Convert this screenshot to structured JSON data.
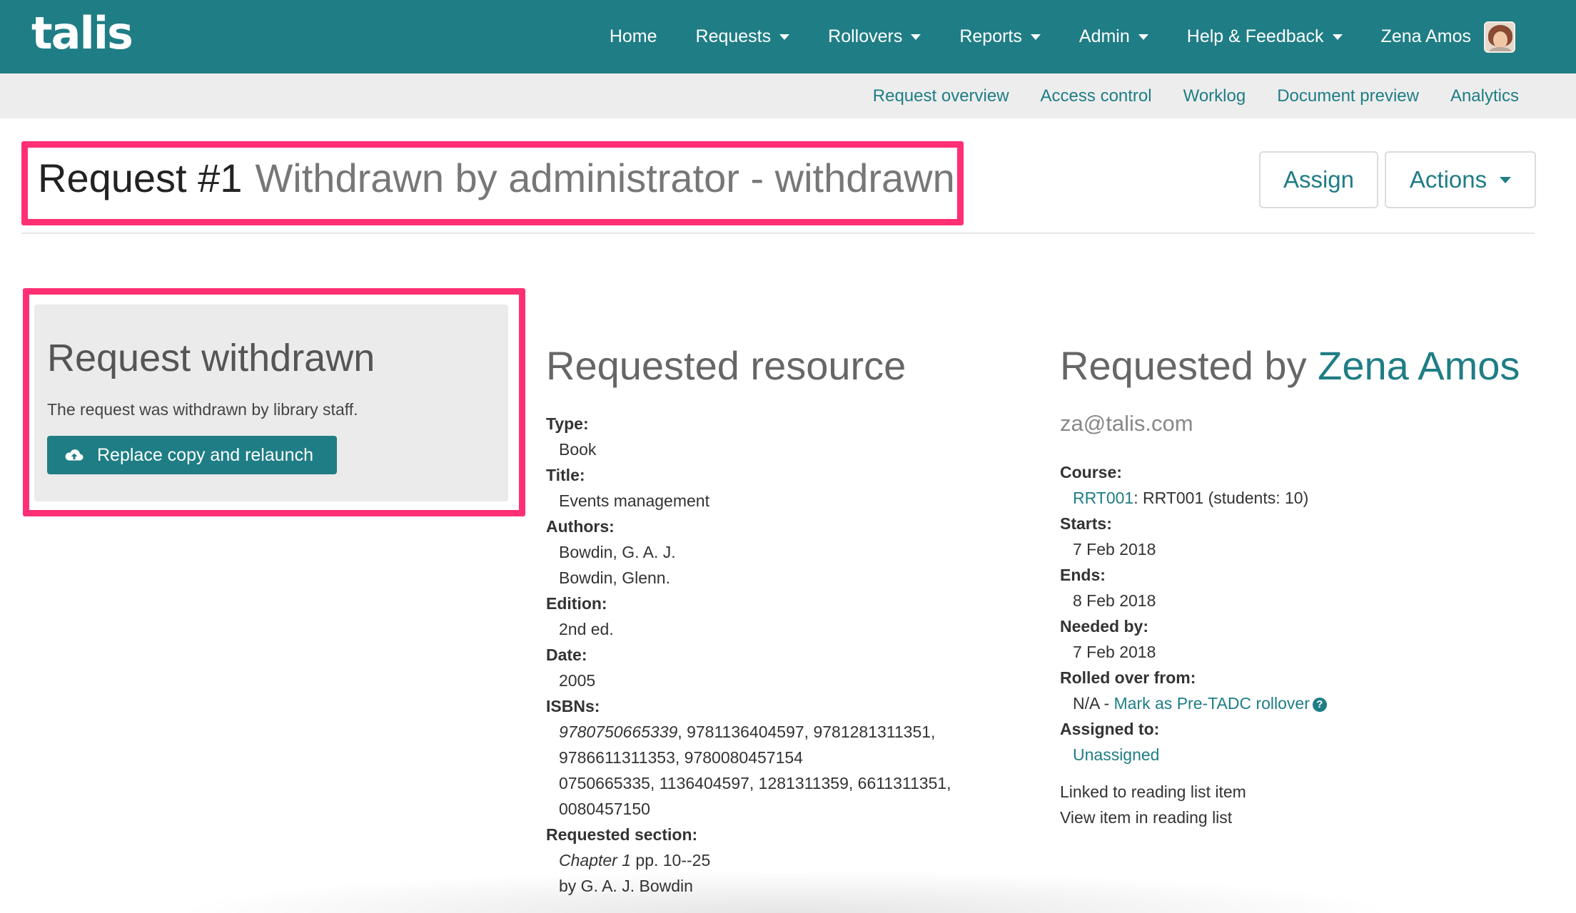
{
  "nav": {
    "logo": "talis",
    "items": [
      {
        "label": "Home",
        "dropdown": false
      },
      {
        "label": "Requests",
        "dropdown": true
      },
      {
        "label": "Rollovers",
        "dropdown": true
      },
      {
        "label": "Reports",
        "dropdown": true
      },
      {
        "label": "Admin",
        "dropdown": true
      },
      {
        "label": "Help & Feedback",
        "dropdown": true
      }
    ],
    "user_name": "Zena Amos",
    "bg_color": "#1f7d85"
  },
  "subnav": {
    "items": [
      "Request overview",
      "Access control",
      "Worklog",
      "Document preview",
      "Analytics"
    ]
  },
  "header": {
    "request": "Request #1",
    "status": "Withdrawn by administrator - withdrawn",
    "assign_label": "Assign",
    "actions_label": "Actions"
  },
  "withdrawn_panel": {
    "title": "Request withdrawn",
    "text": "The request was withdrawn by library staff.",
    "button_label": "Replace copy and relaunch",
    "button_icon": "cloud-upload-icon"
  },
  "resource": {
    "title": "Requested resource",
    "type_label": "Type:",
    "type": "Book",
    "title_label": "Title:",
    "book_title": "Events management",
    "authors_label": "Authors:",
    "authors": [
      "Bowdin, G. A. J.",
      "Bowdin, Glenn."
    ],
    "edition_label": "Edition:",
    "edition": "2nd ed.",
    "date_label": "Date:",
    "date": "2005",
    "isbns_label": "ISBNs:",
    "isbn_primary": "9780750665339",
    "isbn_line1_rest": ", 9781136404597, 9781281311351,",
    "isbn_line2": "9786611311353, 9780080457154",
    "isbn_line3": "0750665335, 1136404597, 1281311359, 6611311351,",
    "isbn_line4": "0080457150",
    "section_label": "Requested section:",
    "section_chapter": "Chapter 1",
    "section_pages": " pp. 10--25",
    "section_by": "by G. A. J. Bowdin"
  },
  "requester": {
    "title_prefix": "Requested by ",
    "name": "Zena Amos",
    "email": "za@talis.com",
    "course_label": "Course:",
    "course_code": "RRT001",
    "course_rest": ": RRT001 (students: 10)",
    "starts_label": "Starts:",
    "starts": "7 Feb 2018",
    "ends_label": "Ends:",
    "ends": "8 Feb 2018",
    "needed_label": "Needed by:",
    "needed": "7 Feb 2018",
    "rolled_label": "Rolled over from:",
    "rolled_prefix": "N/A - ",
    "rolled_link": "Mark as Pre-TADC rollover",
    "assigned_label": "Assigned to:",
    "assigned": "Unassigned",
    "linked_text": "Linked to reading list item",
    "linked_link": "View item in reading list"
  }
}
